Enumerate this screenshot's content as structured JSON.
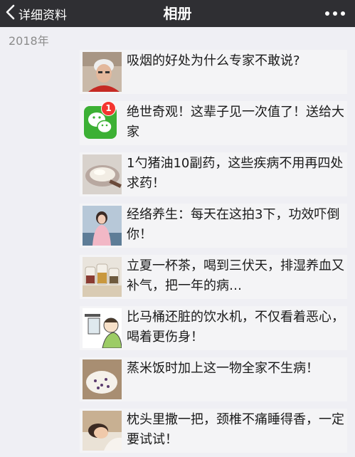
{
  "header": {
    "back_label": "详细资料",
    "title": "相册",
    "back_icon": "chevron-left-icon",
    "more_icon": "more-dots-icon"
  },
  "year_label": "2018年",
  "articles": [
    {
      "text": "吸烟的好处为什么专家不敢说?",
      "thumb": "elderly-woman-photo"
    },
    {
      "text": "绝世奇观！这辈子见一次值了！送给大家",
      "thumb": "wechat-logo",
      "badge": "1"
    },
    {
      "text": "1勺猪油10副药，这些疾病不用再四处求药！",
      "thumb": "lard-spoon-photo"
    },
    {
      "text": "经络养生：每天在这拍3下，功效吓倒你！",
      "thumb": "woman-pink-coat-photo"
    },
    {
      "text": "立夏一杯茶，喝到三伏天，排湿养血又补气，把一年的病…",
      "thumb": "tea-jars-photo"
    },
    {
      "text": "比马桶还脏的饮水机，不仅看着恶心，喝着更伤身！",
      "thumb": "water-dispenser-cartoon"
    },
    {
      "text": "蒸米饭时加上这一物全家不生病！",
      "thumb": "rice-bowl-photo"
    },
    {
      "text": "枕头里撒一把，颈椎不痛睡得香，一定要试试！",
      "thumb": "sleeping-person-photo"
    }
  ],
  "colors": {
    "topbar": "#2f2f33",
    "background": "#efeff4",
    "item_bg": "#f4f4f6",
    "badge": "#f43530",
    "wechat_green": "#3cb034"
  }
}
